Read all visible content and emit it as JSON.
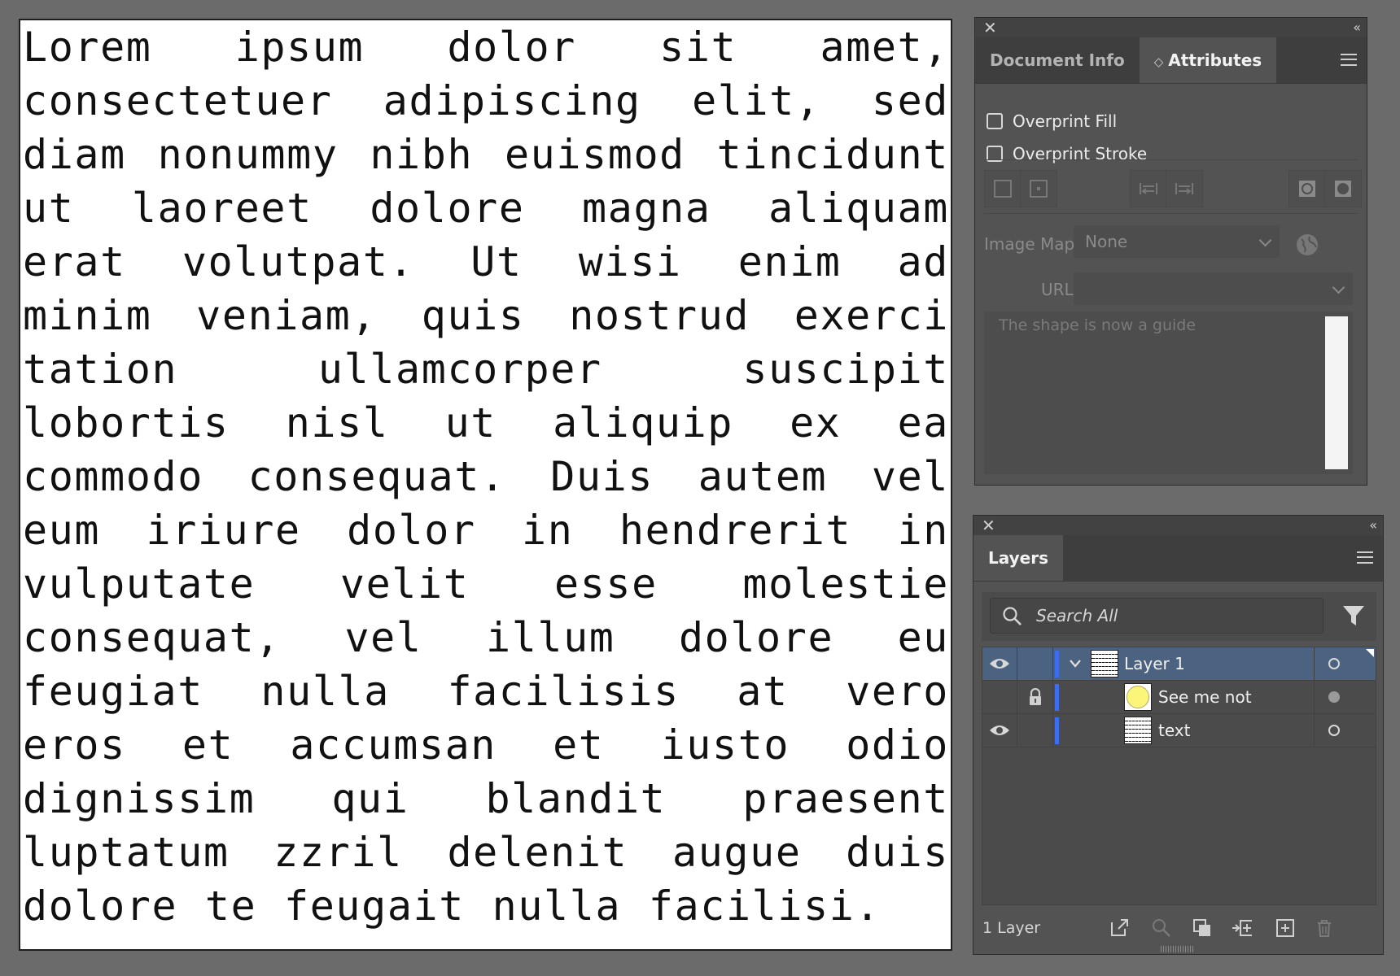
{
  "artboard": {
    "text": "Lorem ipsum dolor sit amet, consectetuer adipiscing elit, sed diam nonummy nibh euismod tincidunt ut laoreet dolore magna aliquam erat volutpat. Ut wisi enim ad minim veniam, quis nostrud exerci tation ullamcorper suscipit lobortis nisl ut aliquip ex ea commodo consequat. Duis autem vel eum iriure dolor in hendrerit in vulputate velit esse molestie consequat, vel illum dolore eu feugiat nulla facilisis at vero eros et accumsan et iusto odio dignissim qui blandit praesent luptatum zzril delenit augue duis dolore te feugait nulla facilisi."
  },
  "attributes_panel": {
    "close_glyph": "✕",
    "collapse_glyph": "‹‹",
    "tabs": [
      {
        "label": "Document Info",
        "active": false
      },
      {
        "label": "Attributes",
        "active": true
      }
    ],
    "active_tab_prefix": "◇",
    "overprint_fill": {
      "label": "Overprint Fill",
      "checked": false
    },
    "overprint_stroke": {
      "label": "Overprint Stroke",
      "checked": false
    },
    "image_map": {
      "label": "Image Map:",
      "value": "None"
    },
    "url": {
      "label": "URL:",
      "value": ""
    },
    "notes": {
      "placeholder": "The shape is now a guide"
    }
  },
  "layers_panel": {
    "close_glyph": "✕",
    "collapse_glyph": "‹‹",
    "tab": "Layers",
    "search": {
      "placeholder": "Search All"
    },
    "rows": [
      {
        "name": "Layer 1",
        "visible": true,
        "locked": false,
        "selected": true,
        "expanded": true,
        "thumbnail": "text-thumbnail"
      },
      {
        "name": "See me not",
        "visible": false,
        "locked": true,
        "selected": false,
        "thumbnail": "yellow-circle-thumbnail"
      },
      {
        "name": "text",
        "visible": true,
        "locked": false,
        "selected": false,
        "thumbnail": "text-thumbnail"
      }
    ],
    "footer": {
      "count": "1 Layer"
    }
  },
  "colors": {
    "layer_color": "#3d6ef0",
    "selected_row": "#4b6280",
    "panel_bg": "#535353",
    "canvas_bg": "#6b6b6b"
  }
}
